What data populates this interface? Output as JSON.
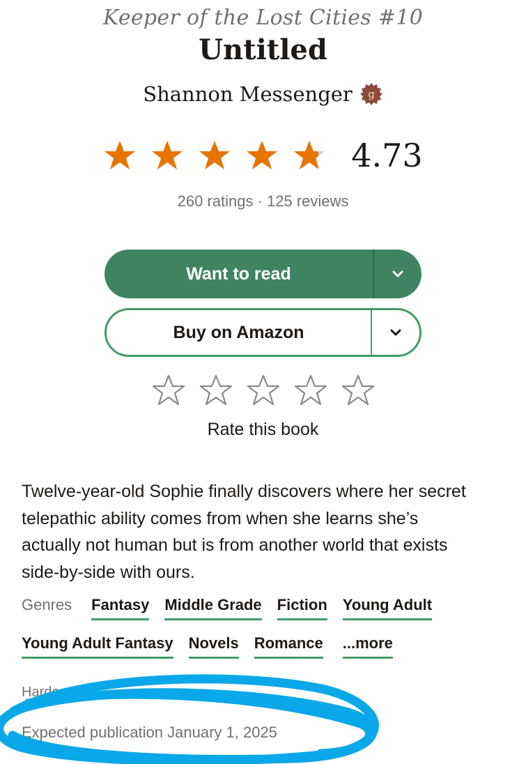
{
  "book": {
    "series": "Keeper of the Lost Cities #10",
    "title": "Untitled",
    "author": "Shannon Messenger",
    "author_badge": "g",
    "average_rating": "4.73",
    "rating_fraction_stars": 4.73,
    "counts": "260 ratings · 125 reviews",
    "description": "Twelve-year-old Sophie finally discovers where her secret telepathic ability comes from when she learns she’s actually not human but is from another world that exists side-by-side with ours.",
    "format": "Hardcover",
    "publication": "Expected publication January 1, 2025"
  },
  "actions": {
    "want_to_read": "Want to read",
    "buy": "Buy on Amazon",
    "rate_label": "Rate this book"
  },
  "genres": {
    "label": "Genres",
    "row1": [
      "Fantasy",
      "Middle Grade",
      "Fiction",
      "Young Adult"
    ],
    "row2": [
      "Young Adult Fantasy",
      "Novels",
      "Romance"
    ],
    "more": "...more"
  },
  "icons": {
    "rating_star": "star-filled-icon",
    "rate_star": "star-outline-icon",
    "dropdown": "chevron-down-icon",
    "author_badge": "goodreads-author-badge-icon"
  },
  "colors": {
    "brand_green": "#409d69",
    "button_green": "#3f8363",
    "star_orange": "#e87400",
    "annotation_blue": "#0aa8e8"
  }
}
